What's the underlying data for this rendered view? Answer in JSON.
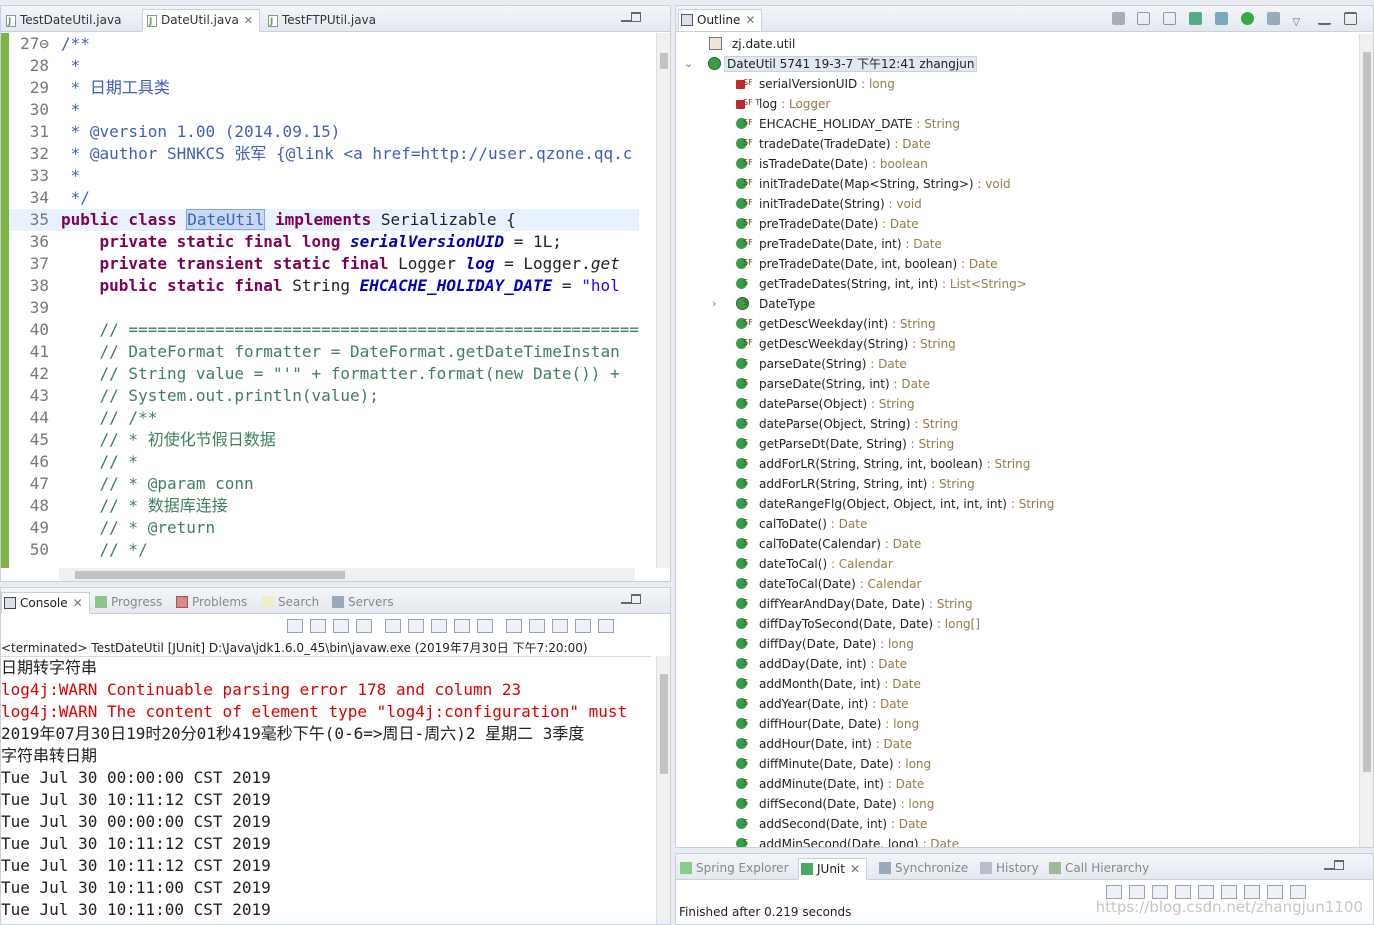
{
  "editor": {
    "tabs": [
      {
        "label": "TestDateUtil.java",
        "active": false
      },
      {
        "label": "DateUtil.java",
        "active": true
      },
      {
        "label": "TestFTPUtil.java",
        "active": false
      }
    ],
    "lines": [
      {
        "n": "27",
        "fold": "⊖",
        "parts": [
          {
            "c": "jd",
            "t": "/**"
          }
        ]
      },
      {
        "n": "28",
        "parts": [
          {
            "c": "jd",
            "t": " *"
          }
        ]
      },
      {
        "n": "29",
        "parts": [
          {
            "c": "jd",
            "t": " * 日期工具类"
          }
        ]
      },
      {
        "n": "30",
        "parts": [
          {
            "c": "jd",
            "t": " *"
          }
        ]
      },
      {
        "n": "31",
        "parts": [
          {
            "c": "jd",
            "t": " * @version 1.00 (2014.09.15)"
          }
        ]
      },
      {
        "n": "32",
        "parts": [
          {
            "c": "jd",
            "t": " * @author SHNKCS 张军 {@link <a href=http://user.qzone.qq.c"
          }
        ]
      },
      {
        "n": "33",
        "parts": [
          {
            "c": "jd",
            "t": " *"
          }
        ]
      },
      {
        "n": "34",
        "parts": [
          {
            "c": "jd",
            "t": " */"
          }
        ]
      },
      {
        "n": "35",
        "cur": true,
        "parts": [
          {
            "c": "kw",
            "t": "public class "
          },
          {
            "c": "sel",
            "t": "DateUtil"
          },
          {
            "c": "",
            "t": " "
          },
          {
            "c": "kw",
            "t": "implements"
          },
          {
            "c": "",
            "t": " Serializable {"
          }
        ]
      },
      {
        "n": "36",
        "parts": [
          {
            "c": "",
            "t": "    "
          },
          {
            "c": "kw",
            "t": "private static final long "
          },
          {
            "c": "fi",
            "t": "serialVersionUID"
          },
          {
            "c": "",
            "t": " = 1L;"
          }
        ]
      },
      {
        "n": "37",
        "parts": [
          {
            "c": "",
            "t": "    "
          },
          {
            "c": "kw",
            "t": "private transient static final"
          },
          {
            "c": "",
            "t": " Logger "
          },
          {
            "c": "fi",
            "t": "log"
          },
          {
            "c": "",
            "t": " = Logger."
          },
          {
            "c": "it",
            "t": "get"
          }
        ]
      },
      {
        "n": "38",
        "parts": [
          {
            "c": "",
            "t": "    "
          },
          {
            "c": "kw",
            "t": "public static final"
          },
          {
            "c": "",
            "t": " String "
          },
          {
            "c": "fi",
            "t": "EHCACHE_HOLIDAY_DATE"
          },
          {
            "c": "",
            "t": " = "
          },
          {
            "c": "st",
            "t": "\"hol"
          }
        ]
      },
      {
        "n": "39",
        "parts": [
          {
            "c": "",
            "t": ""
          }
        ]
      },
      {
        "n": "40",
        "parts": [
          {
            "c": "cm",
            "t": "    // ========================================================="
          }
        ]
      },
      {
        "n": "41",
        "parts": [
          {
            "c": "cm",
            "t": "    // DateFormat formatter = DateFormat.getDateTimeInstan"
          }
        ]
      },
      {
        "n": "42",
        "parts": [
          {
            "c": "cm",
            "t": "    // String value = \"'\" + formatter.format(new Date()) +"
          }
        ]
      },
      {
        "n": "43",
        "parts": [
          {
            "c": "cm",
            "t": "    // System.out.println(value);"
          }
        ]
      },
      {
        "n": "44",
        "parts": [
          {
            "c": "cm",
            "t": "    // /**"
          }
        ]
      },
      {
        "n": "45",
        "parts": [
          {
            "c": "cm",
            "t": "    // * 初使化节假日数据"
          }
        ]
      },
      {
        "n": "46",
        "parts": [
          {
            "c": "cm",
            "t": "    // *"
          }
        ]
      },
      {
        "n": "47",
        "parts": [
          {
            "c": "cm",
            "t": "    // * @param conn"
          }
        ]
      },
      {
        "n": "48",
        "parts": [
          {
            "c": "cm",
            "t": "    // * 数据库连接"
          }
        ]
      },
      {
        "n": "49",
        "parts": [
          {
            "c": "cm",
            "t": "    // * @return"
          }
        ]
      },
      {
        "n": "50",
        "parts": [
          {
            "c": "cm",
            "t": "    // */"
          }
        ]
      }
    ]
  },
  "console": {
    "tabs": [
      {
        "label": "Console",
        "active": true
      },
      {
        "label": "Progress",
        "active": false
      },
      {
        "label": "Problems",
        "active": false
      },
      {
        "label": "Search",
        "active": false
      },
      {
        "label": "Servers",
        "active": false
      }
    ],
    "terminated": "<terminated> TestDateUtil [JUnit] D:\\Java\\jdk1.6.0_45\\bin\\javaw.exe (2019年7月30日 下午7:20:00)",
    "output": [
      {
        "t": "日期转字符串",
        "err": false
      },
      {
        "t": "log4j:WARN Continuable parsing error 178 and column 23",
        "err": true
      },
      {
        "t": "log4j:WARN The content of element type \"log4j:configuration\" must",
        "err": true
      },
      {
        "t": "2019年07月30日19时20分01秒419毫秒下午(0-6=>周日-周六)2 星期二 3季度",
        "err": false
      },
      {
        "t": "字符串转日期",
        "err": false
      },
      {
        "t": "Tue Jul 30 00:00:00 CST 2019",
        "err": false
      },
      {
        "t": "Tue Jul 30 10:11:12 CST 2019",
        "err": false
      },
      {
        "t": "Tue Jul 30 00:00:00 CST 2019",
        "err": false
      },
      {
        "t": "Tue Jul 30 10:11:12 CST 2019",
        "err": false
      },
      {
        "t": "Tue Jul 30 10:11:12 CST 2019",
        "err": false
      },
      {
        "t": "Tue Jul 30 10:11:00 CST 2019",
        "err": false
      },
      {
        "t": "Tue Jul 30 10:11:00 CST 2019",
        "err": false
      }
    ]
  },
  "outline": {
    "title": "Outline",
    "package": "zj.date.util",
    "class_label": "DateUtil 5741  19-3-7 下午12:41  zhangjun",
    "members": [
      {
        "name": "serialVersionUID",
        "type": "long",
        "vis": "priv",
        "mods": "SF"
      },
      {
        "name": "log",
        "type": "Logger",
        "vis": "priv",
        "mods": "SF T"
      },
      {
        "name": "EHCACHE_HOLIDAY_DATE",
        "type": "String",
        "vis": "pub",
        "mods": "SF"
      },
      {
        "name": "tradeDate(TradeDate)",
        "type": "Date",
        "vis": "pub",
        "mods": "SF"
      },
      {
        "name": "isTradeDate(Date)",
        "type": "boolean",
        "vis": "pub",
        "mods": "SF"
      },
      {
        "name": "initTradeDate(Map<String, String>)",
        "type": "void",
        "vis": "pub",
        "mods": "SF"
      },
      {
        "name": "initTradeDate(String)",
        "type": "void",
        "vis": "pub",
        "mods": "SF"
      },
      {
        "name": "preTradeDate(Date)",
        "type": "Date",
        "vis": "pub",
        "mods": "SF"
      },
      {
        "name": "preTradeDate(Date, int)",
        "type": "Date",
        "vis": "pub",
        "mods": "SF"
      },
      {
        "name": "preTradeDate(Date, int, boolean)",
        "type": "Date",
        "vis": "pub",
        "mods": "SF"
      },
      {
        "name": "getTradeDates(String, int, int)",
        "type": "List<String>",
        "vis": "pub",
        "mods": "S"
      },
      {
        "name": "DateType",
        "type": "",
        "vis": "cls",
        "mods": "S",
        "expandable": true
      },
      {
        "name": "getDescWeekday(int)",
        "type": "String",
        "vis": "pub",
        "mods": "SF"
      },
      {
        "name": "getDescWeekday(String)",
        "type": "String",
        "vis": "pub",
        "mods": "SF"
      },
      {
        "name": "parseDate(String)",
        "type": "Date",
        "vis": "pub",
        "mods": "S"
      },
      {
        "name": "parseDate(String, int)",
        "type": "Date",
        "vis": "pub",
        "mods": "S"
      },
      {
        "name": "dateParse(Object)",
        "type": "String",
        "vis": "pub",
        "mods": "S"
      },
      {
        "name": "dateParse(Object, String)",
        "type": "String",
        "vis": "pub",
        "mods": "S"
      },
      {
        "name": "getParseDt(Date, String)",
        "type": "String",
        "vis": "pub",
        "mods": "S"
      },
      {
        "name": "addForLR(String, String, int, boolean)",
        "type": "String",
        "vis": "pub",
        "mods": "S"
      },
      {
        "name": "addForLR(String, String, int)",
        "type": "String",
        "vis": "pub",
        "mods": "S"
      },
      {
        "name": "dateRangeFlg(Object, Object, int, int, int)",
        "type": "String",
        "vis": "pub",
        "mods": "S"
      },
      {
        "name": "calToDate()",
        "type": "Date",
        "vis": "pub",
        "mods": "S"
      },
      {
        "name": "calToDate(Calendar)",
        "type": "Date",
        "vis": "pub",
        "mods": "S"
      },
      {
        "name": "dateToCal()",
        "type": "Calendar",
        "vis": "pub",
        "mods": "S"
      },
      {
        "name": "dateToCal(Date)",
        "type": "Calendar",
        "vis": "pub",
        "mods": "S"
      },
      {
        "name": "diffYearAndDay(Date, Date)",
        "type": "String",
        "vis": "pub",
        "mods": "S"
      },
      {
        "name": "diffDayToSecond(Date, Date)",
        "type": "long[]",
        "vis": "pub",
        "mods": "S"
      },
      {
        "name": "diffDay(Date, Date)",
        "type": "long",
        "vis": "pub",
        "mods": "S"
      },
      {
        "name": "addDay(Date, int)",
        "type": "Date",
        "vis": "pub",
        "mods": "S"
      },
      {
        "name": "addMonth(Date, int)",
        "type": "Date",
        "vis": "pub",
        "mods": "S"
      },
      {
        "name": "addYear(Date, int)",
        "type": "Date",
        "vis": "pub",
        "mods": "S"
      },
      {
        "name": "diffHour(Date, Date)",
        "type": "long",
        "vis": "pub",
        "mods": "S"
      },
      {
        "name": "addHour(Date, int)",
        "type": "Date",
        "vis": "pub",
        "mods": "S"
      },
      {
        "name": "diffMinute(Date, Date)",
        "type": "long",
        "vis": "pub",
        "mods": "S"
      },
      {
        "name": "addMinute(Date, int)",
        "type": "Date",
        "vis": "pub",
        "mods": "S"
      },
      {
        "name": "diffSecond(Date, Date)",
        "type": "long",
        "vis": "pub",
        "mods": "S"
      },
      {
        "name": "addSecond(Date, int)",
        "type": "Date",
        "vis": "pub",
        "mods": "S"
      },
      {
        "name": "addMinSecond(Date, long)",
        "type": "Date",
        "vis": "pub",
        "mods": "S"
      }
    ]
  },
  "junit": {
    "tabs": [
      {
        "label": "Spring Explorer",
        "active": false
      },
      {
        "label": "JUnit",
        "active": true
      },
      {
        "label": "Synchronize",
        "active": false
      },
      {
        "label": "History",
        "active": false
      },
      {
        "label": "Call Hierarchy",
        "active": false
      }
    ],
    "finished": "Finished after 0.219 seconds",
    "watermark": "https://blog.csdn.net/zhangjun1100"
  }
}
